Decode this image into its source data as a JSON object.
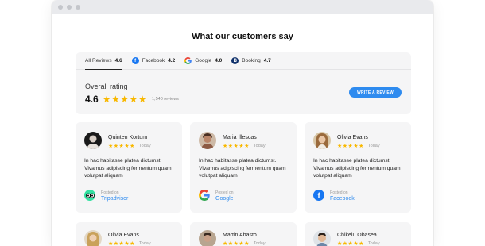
{
  "page": {
    "title": "What our customers say"
  },
  "colors": {
    "accent": "#2e8bef",
    "star": "#f8b800",
    "facebook": "#1877f2",
    "booking": "#10316b",
    "tripadvisor": "#34e0a1"
  },
  "tabs": [
    {
      "label": "All Reviews",
      "value": "4.6",
      "icon": ""
    },
    {
      "label": "Facebook",
      "value": "4.2",
      "icon": "facebook-icon"
    },
    {
      "label": "Google",
      "value": "4.0",
      "icon": "google-icon"
    },
    {
      "label": "Booking",
      "value": "4.7",
      "icon": "booking-icon"
    }
  ],
  "summary": {
    "label": "Overall rating",
    "score": "4.6",
    "stars": "★★★★★",
    "count": "1,540 reviews",
    "button": "WRITE A REVIEW"
  },
  "reviews": [
    {
      "name": "Quinten Kortum",
      "stars": "★★★★★",
      "date": "Today",
      "text": "In hac habitasse platea dictumst. Vivamus adipiscing fermentum quam volutpat aliquam",
      "posted_label": "Posted on",
      "source": "Tripadvisor",
      "source_icon": "tripadvisor-icon"
    },
    {
      "name": "Maria Illescas",
      "stars": "★★★★★",
      "date": "Today",
      "text": "In hac habitasse platea dictumst. Vivamus adipiscing fermentum quam volutpat aliquam",
      "posted_label": "Posted on",
      "source": "Google",
      "source_icon": "google-icon"
    },
    {
      "name": "Olivia Evans",
      "stars": "★★★★★",
      "date": "Today",
      "text": "In hac habitasse platea dictumst. Vivamus adipiscing fermentum quam volutpat aliquam",
      "posted_label": "Posted on",
      "source": "Facebook",
      "source_icon": "facebook-icon"
    },
    {
      "name": "Olivia Evans",
      "stars": "★★★★★",
      "date": "Today"
    },
    {
      "name": "Martin Abasto",
      "stars": "★★★★★",
      "date": "Today"
    },
    {
      "name": "Chikelu Obasea",
      "stars": "★★★★★",
      "date": "Today"
    }
  ]
}
